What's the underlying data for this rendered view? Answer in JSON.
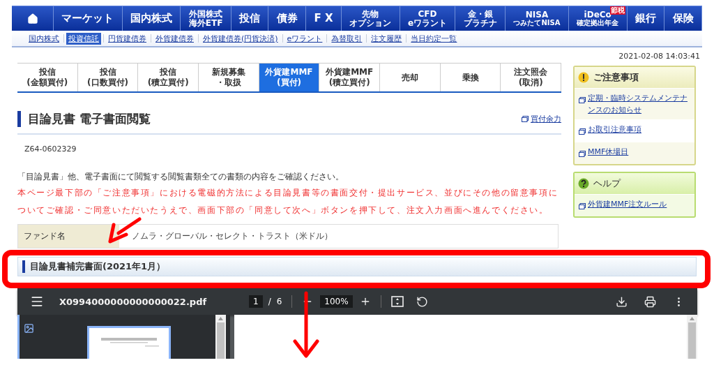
{
  "global_nav": [
    {
      "kind": "home"
    },
    {
      "kind": "text",
      "lines": [
        "マーケット"
      ]
    },
    {
      "kind": "text",
      "lines": [
        "国内株式"
      ]
    },
    {
      "kind": "text",
      "lines": [
        "外国株式",
        "海外ETF"
      ]
    },
    {
      "kind": "text",
      "lines": [
        "投信"
      ]
    },
    {
      "kind": "text",
      "lines": [
        "債券"
      ]
    },
    {
      "kind": "text",
      "lines": [
        "F X"
      ]
    },
    {
      "kind": "text",
      "lines": [
        "先物",
        "オプション"
      ]
    },
    {
      "kind": "text",
      "lines": [
        "CFD",
        "eワラント"
      ]
    },
    {
      "kind": "text",
      "lines": [
        "金・銀",
        "プラチナ"
      ]
    },
    {
      "kind": "text",
      "lines": [
        "NISA",
        "つみたてNISA"
      ]
    },
    {
      "kind": "text",
      "lines": [
        "iDeCo",
        "確定拠出年金"
      ],
      "badge": "節税"
    },
    {
      "kind": "text",
      "lines": [
        "銀行"
      ]
    },
    {
      "kind": "text",
      "lines": [
        "保険"
      ]
    }
  ],
  "sub_nav": [
    {
      "label": "国内株式",
      "selected": false
    },
    {
      "label": "投資信託",
      "selected": true
    },
    {
      "label": "円貨建債券",
      "selected": false
    },
    {
      "label": "外貨建債券",
      "selected": false
    },
    {
      "label": "外貨建債券(円貨決済)",
      "selected": false
    },
    {
      "label": "eワラント",
      "selected": false
    },
    {
      "label": "為替取引",
      "selected": false
    },
    {
      "label": "注文履歴",
      "selected": false
    },
    {
      "label": "当日約定一覧",
      "selected": false
    }
  ],
  "timestamp": "2021-02-08 14:03:41",
  "tabs": [
    {
      "lines": [
        "投信",
        "(金額買付)"
      ],
      "selected": false
    },
    {
      "lines": [
        "投信",
        "(口数買付)"
      ],
      "selected": false
    },
    {
      "lines": [
        "投信",
        "(積立買付)"
      ],
      "selected": false
    },
    {
      "lines": [
        "新規募集",
        "・取扱"
      ],
      "selected": false
    },
    {
      "lines": [
        "外貨建MMF",
        "(買付)"
      ],
      "selected": true
    },
    {
      "lines": [
        "外貨建MMF",
        "(積立買付)"
      ],
      "selected": false
    },
    {
      "lines": [
        "売却"
      ],
      "selected": false
    },
    {
      "lines": [
        "乗換"
      ],
      "selected": false
    },
    {
      "lines": [
        "注文照会",
        "(取消)"
      ],
      "selected": false
    }
  ],
  "page_title": "目論見書 電子書面閲覧",
  "buying_power_link": "買付余力",
  "screen_code": "Z64-0602329",
  "notice": "「目論見書」他、電子書面にて閲覧する閲覧書類全ての書類の内容をご確認ください。",
  "warning": "本ページ最下部の「ご注意事項」における電磁的方法による目論見書等の書面交付・提出サービス、並びにその他の留意事項についてご確認・ご同意いただいたうえで、画面下部の「同意して次へ」ボタンを押下して、注文入力画面へ進んでください。",
  "fund": {
    "label": "ファンド名",
    "value": "ノムラ・グローバル・セレクト・トラスト（米ドル）"
  },
  "side_panels": [
    {
      "kind": "caution",
      "title": "ご注意事項",
      "links": [
        "定期・臨時システムメンテナンスのお知らせ",
        "お取引注意事項",
        "MMF休場日"
      ]
    },
    {
      "kind": "help",
      "title": "ヘルプ",
      "links": [
        "外貨建MMF注文ルール"
      ]
    }
  ],
  "section_title": "目論見書補完書面(2021年1月）",
  "pdf_viewer": {
    "file_name": "X0994000000000000022.pdf",
    "page": "1",
    "page_count": "6",
    "separator": "/",
    "zoom": "100%"
  }
}
